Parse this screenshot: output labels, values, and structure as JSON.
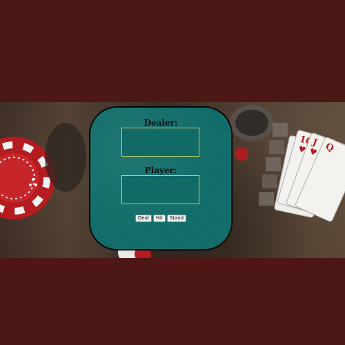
{
  "table": {
    "dealer_label": "Dealer:",
    "player_label": "Player:"
  },
  "controls": {
    "deal_label": "Deal",
    "hit_label": "Hit",
    "stand_label": "Stand"
  },
  "colors": {
    "page_background": "#4d1715",
    "felt": "#0f6e6a",
    "hand_border": "#c8d26a"
  },
  "background_art": {
    "chip_icon": "casino-chip-icon",
    "cards_icon": "playing-cards-icon"
  }
}
